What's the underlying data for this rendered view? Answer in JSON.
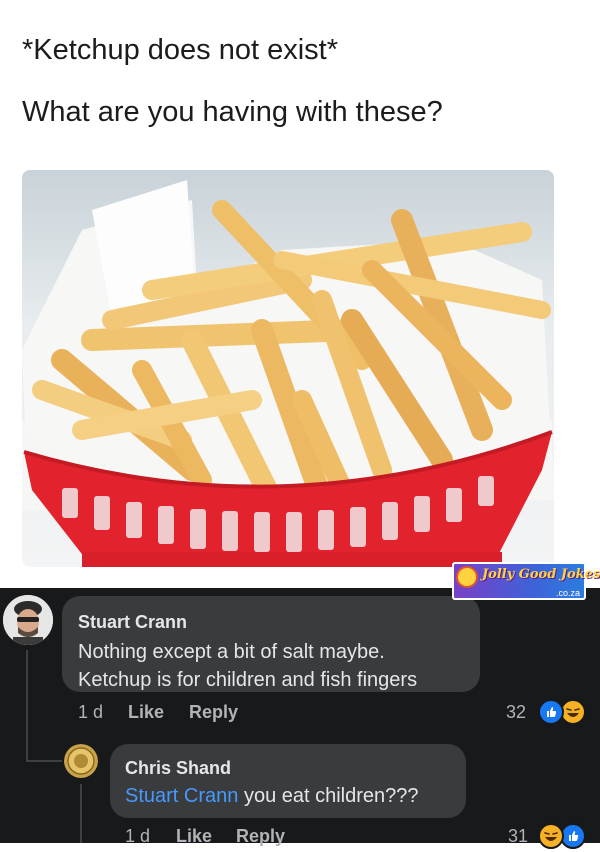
{
  "post": {
    "line1": "*Ketchup does not exist*",
    "line2": "What are you having with these?"
  },
  "watermark": {
    "text": "Jolly Good Jokes",
    "domain": ".co.za"
  },
  "comments": [
    {
      "author": "Stuart Crann",
      "text_lines": [
        "Nothing except a bit of salt maybe.",
        "Ketchup is for children and fish fingers"
      ],
      "age": "1 d",
      "like_label": "Like",
      "reply_label": "Reply",
      "reaction_count": "32",
      "reactions": [
        "like-icon",
        "haha-icon"
      ]
    },
    {
      "author": "Chris Shand",
      "mention": "Stuart Crann",
      "text": " you eat children???",
      "age": "1 d",
      "like_label": "Like",
      "reply_label": "Reply",
      "reaction_count": "31",
      "reactions": [
        "haha-icon",
        "like-icon"
      ]
    }
  ],
  "colors": {
    "dark_bg": "#18191a",
    "bubble": "#3a3b3c",
    "mention": "#4599ff",
    "basket_red": "#e2232e"
  }
}
